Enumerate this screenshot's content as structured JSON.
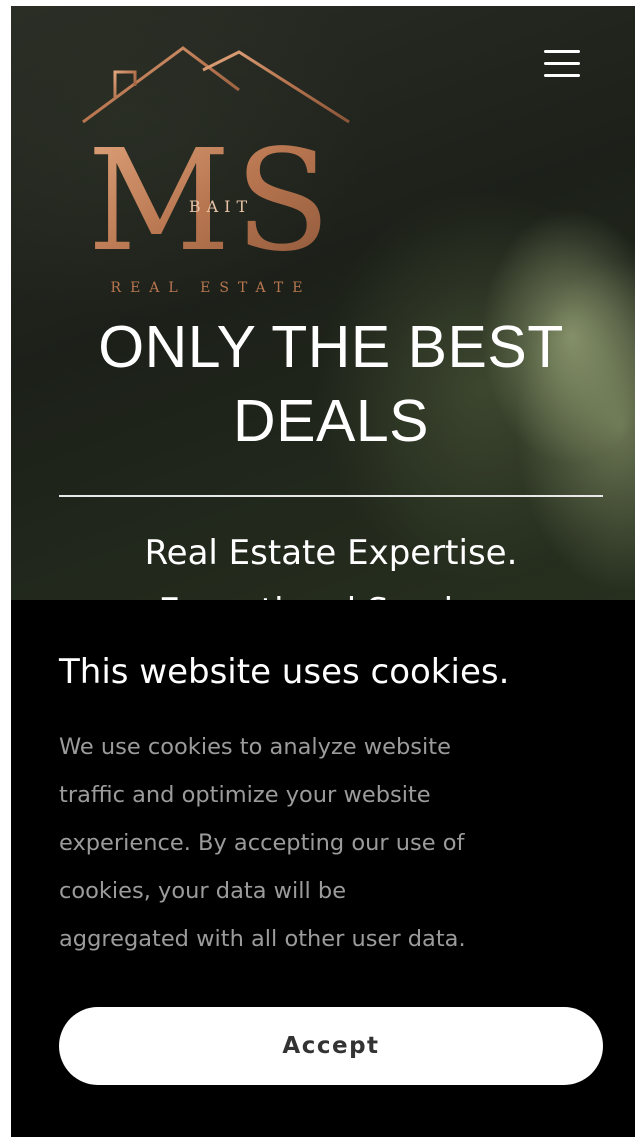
{
  "header": {
    "logo": {
      "monogram": "MS",
      "overlay": "BAIT",
      "tagline": "REAL ESTATE"
    },
    "menu_icon": "hamburger-menu-icon"
  },
  "hero": {
    "title": "ONLY THE BEST DEALS",
    "subtitle": "Real Estate Expertise.\nExceptional Service."
  },
  "cookie_banner": {
    "title": "This website uses cookies.",
    "body": "We use cookies to analyze website\ntraffic and optimize your website\nexperience. By accepting our use of\ncookies, your data will be\naggregated with all other user data.",
    "accept_label": "Accept"
  },
  "colors": {
    "brand_copper": "#c48a62",
    "banner_background": "#000000",
    "banner_text": "#9b9b9b",
    "button_background": "#ffffff"
  }
}
